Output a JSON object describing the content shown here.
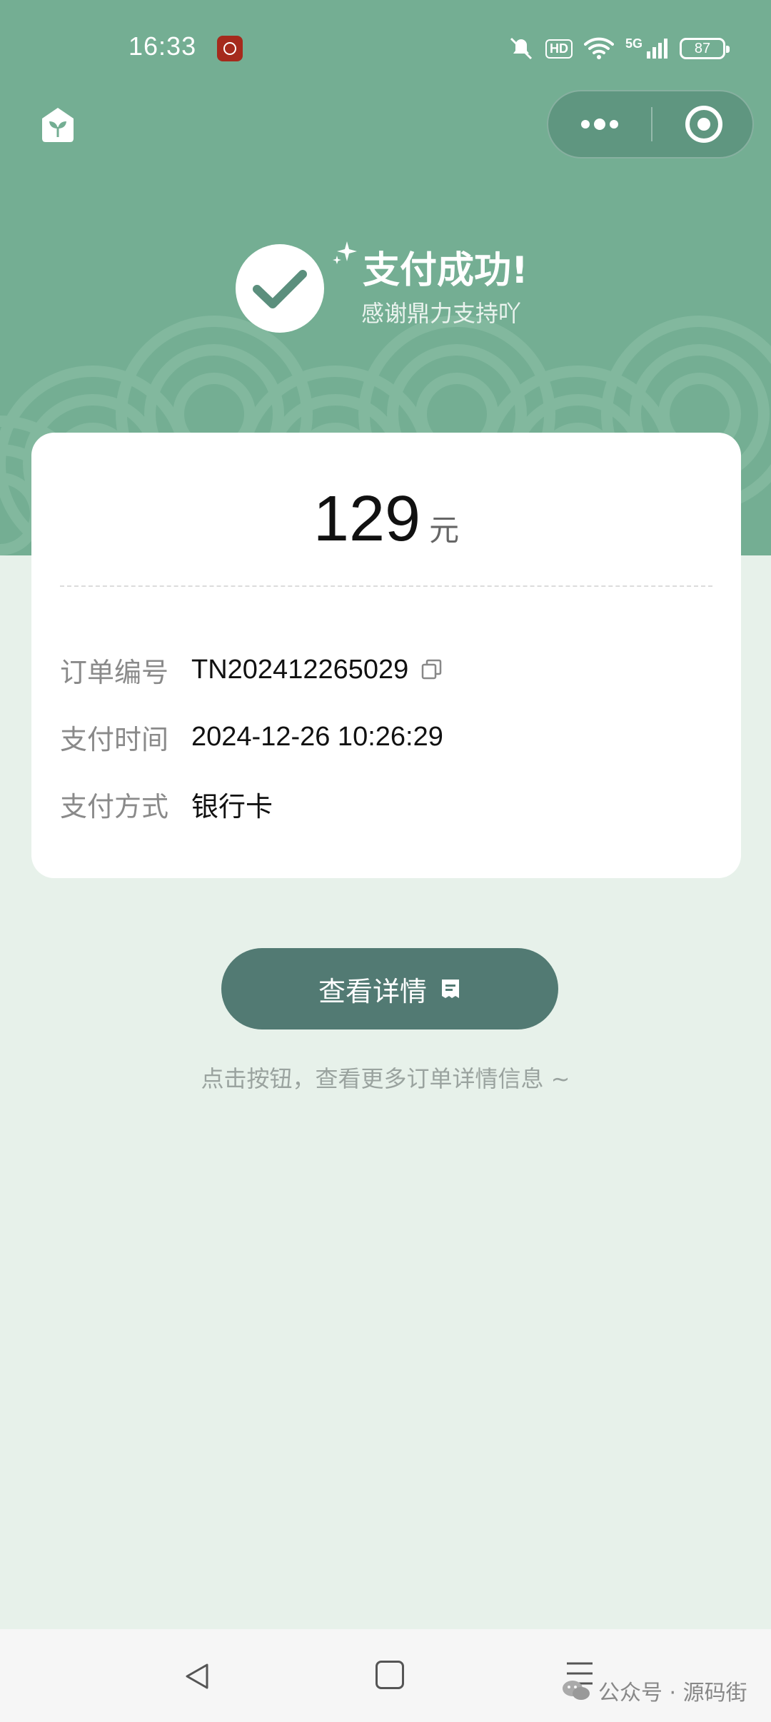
{
  "status_bar": {
    "time": "16:33",
    "hd": "HD",
    "network": "5G",
    "battery": "87"
  },
  "header": {
    "success_title": "支付成功!",
    "success_subtitle": "感谢鼎力支持吖"
  },
  "card": {
    "amount": "129",
    "currency": "元",
    "rows": [
      {
        "label": "订单编号",
        "value": "TN202412265029"
      },
      {
        "label": "支付时间",
        "value": "2024-12-26 10:26:29"
      },
      {
        "label": "支付方式",
        "value": "银行卡"
      }
    ]
  },
  "actions": {
    "detail_button": "查看详情",
    "hint": "点击按钮，查看更多订单详情信息 ~"
  },
  "watermark": "公众号 · 源码街",
  "colors": {
    "header_bg": "#74ae93",
    "page_bg": "#e7f1ea",
    "button_bg": "#527a73",
    "capsule_bg": "#5f9680"
  },
  "icons": [
    "home-icon",
    "more-dots-icon",
    "close-mini-icon",
    "check-icon",
    "sparkle-icon",
    "copy-icon",
    "receipt-icon",
    "back-icon",
    "home-square-icon",
    "menu-icon",
    "wechat-icon",
    "mute-icon",
    "wifi-icon",
    "signal-icon",
    "battery-icon"
  ]
}
